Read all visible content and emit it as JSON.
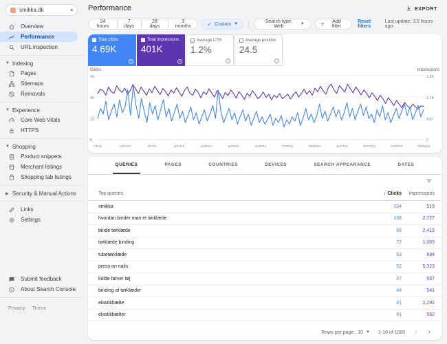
{
  "sidebar": {
    "property": {
      "label": "smikka.dk"
    },
    "items": [
      {
        "type": "item",
        "icon": "home-icon",
        "label": "Overview"
      },
      {
        "type": "item",
        "icon": "performance-icon",
        "label": "Performance",
        "active": true
      },
      {
        "type": "item",
        "icon": "search-icon",
        "label": "URL inspection"
      },
      {
        "type": "divider"
      },
      {
        "type": "section",
        "label": "Indexing",
        "expanded": true
      },
      {
        "type": "item",
        "icon": "pages-icon",
        "label": "Pages"
      },
      {
        "type": "item",
        "icon": "sitemaps-icon",
        "label": "Sitemaps"
      },
      {
        "type": "item",
        "icon": "removals-icon",
        "label": "Removals"
      },
      {
        "type": "divider"
      },
      {
        "type": "section",
        "label": "Experience",
        "expanded": true
      },
      {
        "type": "item",
        "icon": "core-web-vitals-icon",
        "label": "Core Web Vitals"
      },
      {
        "type": "item",
        "icon": "https-icon",
        "label": "HTTPS"
      },
      {
        "type": "divider"
      },
      {
        "type": "section",
        "label": "Shopping",
        "expanded": true
      },
      {
        "type": "item",
        "icon": "product-snippets-icon",
        "label": "Product snippets"
      },
      {
        "type": "item",
        "icon": "merchant-listings-icon",
        "label": "Merchant listings"
      },
      {
        "type": "item",
        "icon": "shopping-tab-icon",
        "label": "Shopping tab listings"
      },
      {
        "type": "divider"
      },
      {
        "type": "section",
        "label": "Security & Manual Actions",
        "expanded": false
      },
      {
        "type": "divider"
      },
      {
        "type": "item",
        "icon": "links-icon",
        "label": "Links"
      },
      {
        "type": "item",
        "icon": "settings-icon",
        "label": "Settings"
      }
    ],
    "footer_items": [
      {
        "icon": "feedback-icon",
        "label": "Submit feedback"
      },
      {
        "icon": "info-icon",
        "label": "About Search Console"
      }
    ],
    "legal": [
      "Privacy",
      "Terms"
    ]
  },
  "header": {
    "title": "Performance",
    "export_label": "EXPORT"
  },
  "filters": {
    "date_buttons": [
      "24 hours",
      "7 days",
      "28 days",
      "3 months"
    ],
    "custom_label": "Custom",
    "search_type_label": "Search type: Web",
    "add_filter_label": "Add filter",
    "reset_label": "Reset filters",
    "last_update": "Last update: 3.5 hours ago"
  },
  "metrics": [
    {
      "label": "Total clicks",
      "value": "4.69K",
      "selected": true,
      "color": "#4285f4"
    },
    {
      "label": "Total impressions",
      "value": "401K",
      "selected": true,
      "color": "#5e35b1"
    },
    {
      "label": "Average CTR",
      "value": "1.2%",
      "selected": false,
      "color": ""
    },
    {
      "label": "Average position",
      "value": "24.5",
      "selected": false,
      "color": ""
    }
  ],
  "chart_data": {
    "type": "line",
    "title": "Clicks and impressions over time",
    "x_labels": [
      "1/1/24",
      "1/31/24",
      "3/1/24",
      "3/31/24",
      "4/30/24",
      "5/30/24",
      "6/29/24",
      "7/29/24",
      "8/28/24",
      "9/27/24",
      "10/27/24",
      "11/26/24",
      "12/26/24"
    ],
    "y_left": {
      "label": "Clicks",
      "ticks": [
        "45",
        "30",
        "15",
        "0"
      ],
      "max": 45
    },
    "y_right": {
      "label": "Impressions",
      "ticks": [
        "1.8K",
        "1.2K",
        "600",
        "0"
      ],
      "max": 1800
    },
    "grid": true,
    "legend_position": "none",
    "series": [
      {
        "name": "Clicks",
        "axis": "left",
        "color": "#4285f4",
        "values": [
          15,
          22,
          18,
          27,
          14,
          20,
          25,
          16,
          28,
          19,
          23,
          35,
          17,
          38,
          24,
          15,
          29,
          20,
          12,
          26,
          18,
          24,
          14,
          21,
          28,
          16,
          22,
          13,
          19,
          25,
          15,
          20,
          12,
          17,
          23,
          14,
          19,
          11,
          16,
          21,
          13,
          18,
          24,
          15,
          35,
          20,
          12,
          17,
          22,
          14,
          19,
          11,
          16,
          21,
          13,
          18,
          10,
          15,
          20,
          12,
          16,
          11,
          14,
          18,
          10,
          15,
          12,
          17,
          9,
          14,
          11,
          16,
          13,
          19,
          10,
          15,
          22,
          14,
          18,
          12,
          17,
          25,
          15,
          20,
          13,
          18,
          23,
          16,
          21,
          14,
          19,
          26,
          16,
          22,
          14,
          20,
          25,
          17,
          23,
          15,
          18,
          12,
          21,
          16,
          24,
          14,
          19,
          12,
          17,
          22,
          15,
          20,
          25,
          17,
          23,
          14,
          19,
          24,
          16,
          21
        ]
      },
      {
        "name": "Impressions",
        "axis": "right",
        "color": "#5e35b1",
        "values": [
          1300,
          1420,
          1380,
          1250,
          1480,
          1350,
          1300,
          1520,
          1400,
          1330,
          1450,
          1280,
          1380,
          1550,
          1420,
          1300,
          1480,
          1360,
          1250,
          1430,
          1320,
          1500,
          1380,
          1270,
          1440,
          1350,
          1230,
          1400,
          1310,
          1460,
          1340,
          1220,
          1390,
          1480,
          1300,
          1250,
          1420,
          1330,
          1180,
          1350,
          1270,
          1430,
          1310,
          1200,
          1380,
          1290,
          1160,
          1330,
          1240,
          1400,
          1300,
          1170,
          1350,
          1260,
          1130,
          1310,
          1220,
          1380,
          1280,
          1150,
          1230,
          1340,
          1190,
          1280,
          1120,
          1250,
          1180,
          1300,
          1150,
          1220,
          1280,
          1140,
          1260,
          1350,
          1200,
          1300,
          1420,
          1280,
          1380,
          1250,
          1450,
          1350,
          1500,
          1380,
          1280,
          1480,
          1560,
          1400,
          1300,
          1520,
          1430,
          1340,
          1560,
          1440,
          1320,
          1480,
          1380,
          1260,
          1400,
          1300,
          1180,
          1320,
          1220,
          1100,
          1250,
          1150,
          1020,
          1180,
          1080,
          960,
          1100,
          1000,
          900,
          1050,
          950,
          880,
          1000,
          920,
          860,
          950,
          940
        ]
      }
    ]
  },
  "table": {
    "tabs": [
      {
        "label": "QUERIES",
        "active": true
      },
      {
        "label": "PAGES",
        "active": false
      },
      {
        "label": "COUNTRIES",
        "active": false
      },
      {
        "label": "DEVICES",
        "active": false
      },
      {
        "label": "SEARCH APPEARANCE",
        "active": false
      },
      {
        "label": "DATES",
        "active": false
      }
    ],
    "columns": [
      "Top queries",
      "Clicks",
      "Impressions"
    ],
    "rows": [
      {
        "query": "smikka",
        "clicks": "154",
        "impressions": "519"
      },
      {
        "query": "hvordan binder man et tørklæde",
        "clicks": "138",
        "impressions": "2,727"
      },
      {
        "query": "binde tørklæde",
        "clicks": "88",
        "impressions": "2,415"
      },
      {
        "query": "tørklæde binding",
        "clicks": "72",
        "impressions": "1,069"
      },
      {
        "query": "tubetørklæde",
        "clicks": "53",
        "impressions": "884"
      },
      {
        "query": "press on nails",
        "clicks": "52",
        "impressions": "5,323"
      },
      {
        "query": "kolde farver tøj",
        "clicks": "47",
        "impressions": "657"
      },
      {
        "query": "binding af tørklæder",
        "clicks": "44",
        "impressions": "541"
      },
      {
        "query": "elastikbælte",
        "clicks": "41",
        "impressions": "2,292"
      },
      {
        "query": "elastikbælter",
        "clicks": "41",
        "impressions": "562"
      }
    ],
    "pagination": {
      "rows_per_page_label": "Rows per page:",
      "rows_per_page": "10",
      "range": "1-10 of 1000"
    }
  },
  "colors": {
    "clicks_blue": "#4285f4",
    "impressions_purple": "#5e35b1",
    "link_blue": "#1a73e8",
    "active_nav_bg": "#d3e3fc",
    "active_nav_text": "#174ea6",
    "background": "#f1f3f4"
  }
}
